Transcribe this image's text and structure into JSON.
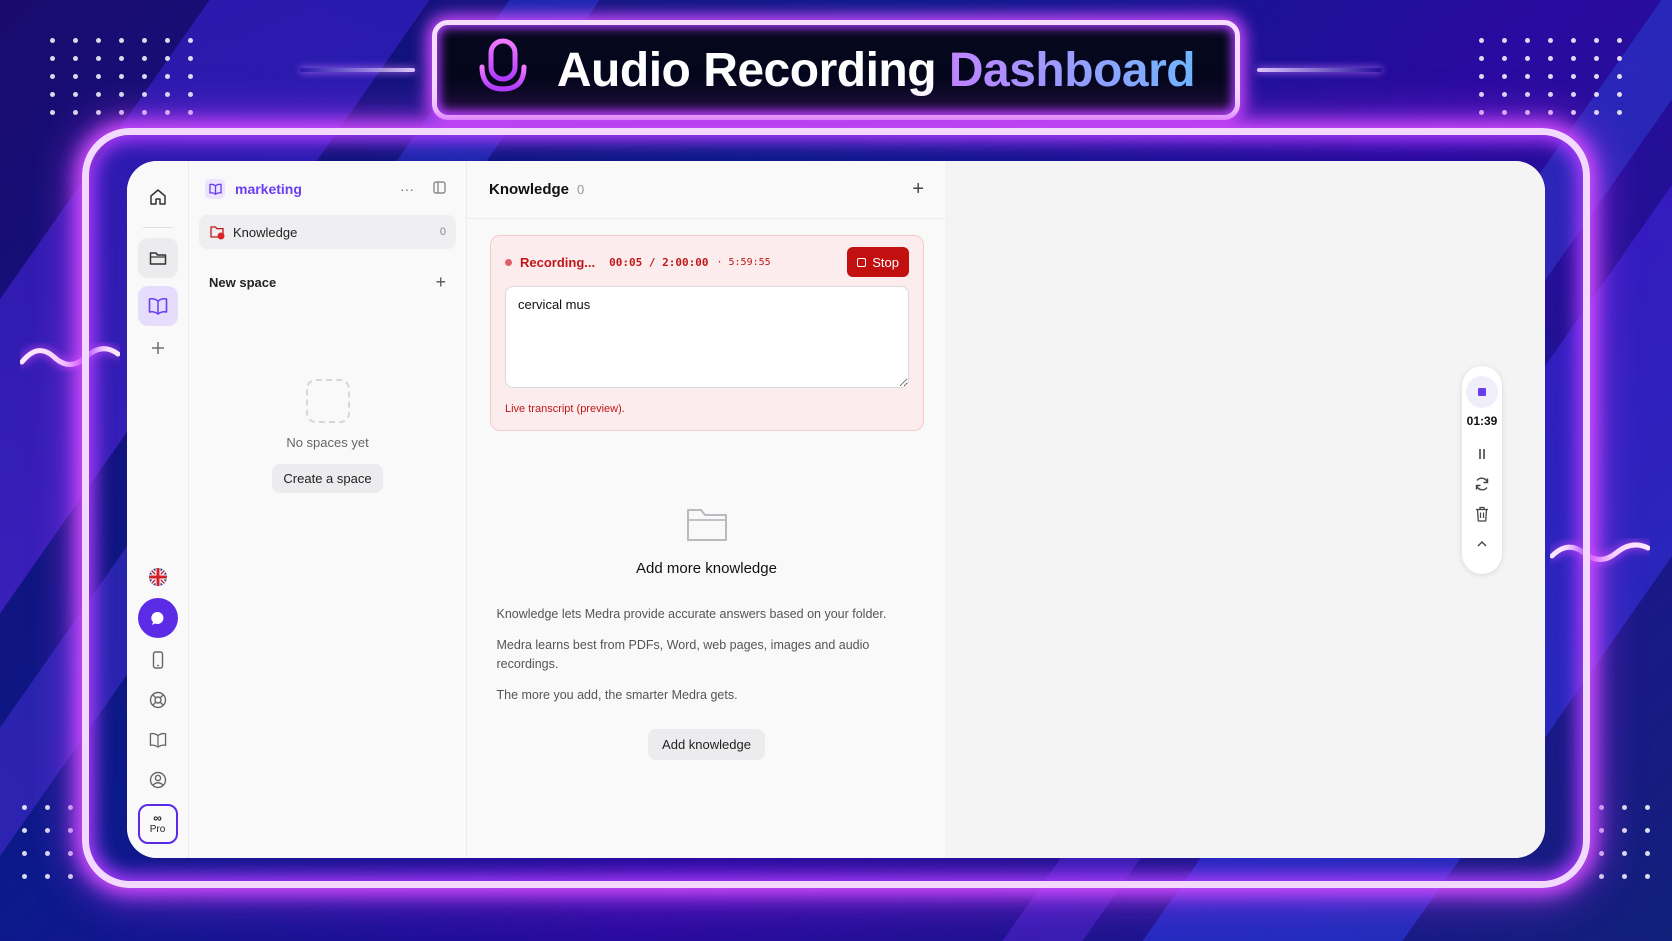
{
  "banner": {
    "title_main": "Audio Recording ",
    "title_accent": "Dashboard"
  },
  "workspace": {
    "name": "marketing"
  },
  "sidebar": {
    "knowledge_label": "Knowledge",
    "knowledge_count": "0",
    "new_space_label": "New space",
    "empty_text": "No spaces yet",
    "create_label": "Create a space"
  },
  "main": {
    "title": "Knowledge",
    "count": "0",
    "recording": {
      "label": "Recording...",
      "elapsed": "00:05 / 2:00:00",
      "remaining": "· 5:59:55",
      "stop_label": "Stop",
      "transcript": "cervical mus",
      "note": "Live transcript (preview)."
    },
    "empty": {
      "title": "Add more knowledge",
      "p1": "Knowledge lets Medra provide accurate answers based on your folder.",
      "p2": "Medra learns best from PDFs, Word, web pages, images and audio recordings.",
      "p3": "The more you add, the smarter Medra gets.",
      "button": "Add knowledge"
    }
  },
  "recorder_widget": {
    "time": "01:39"
  },
  "rail": {
    "pro_label": "Pro",
    "pro_glyph": "∞"
  },
  "colors": {
    "accent": "#6b3df0",
    "record_red": "#c20f0f",
    "neon": "#d44cff"
  }
}
